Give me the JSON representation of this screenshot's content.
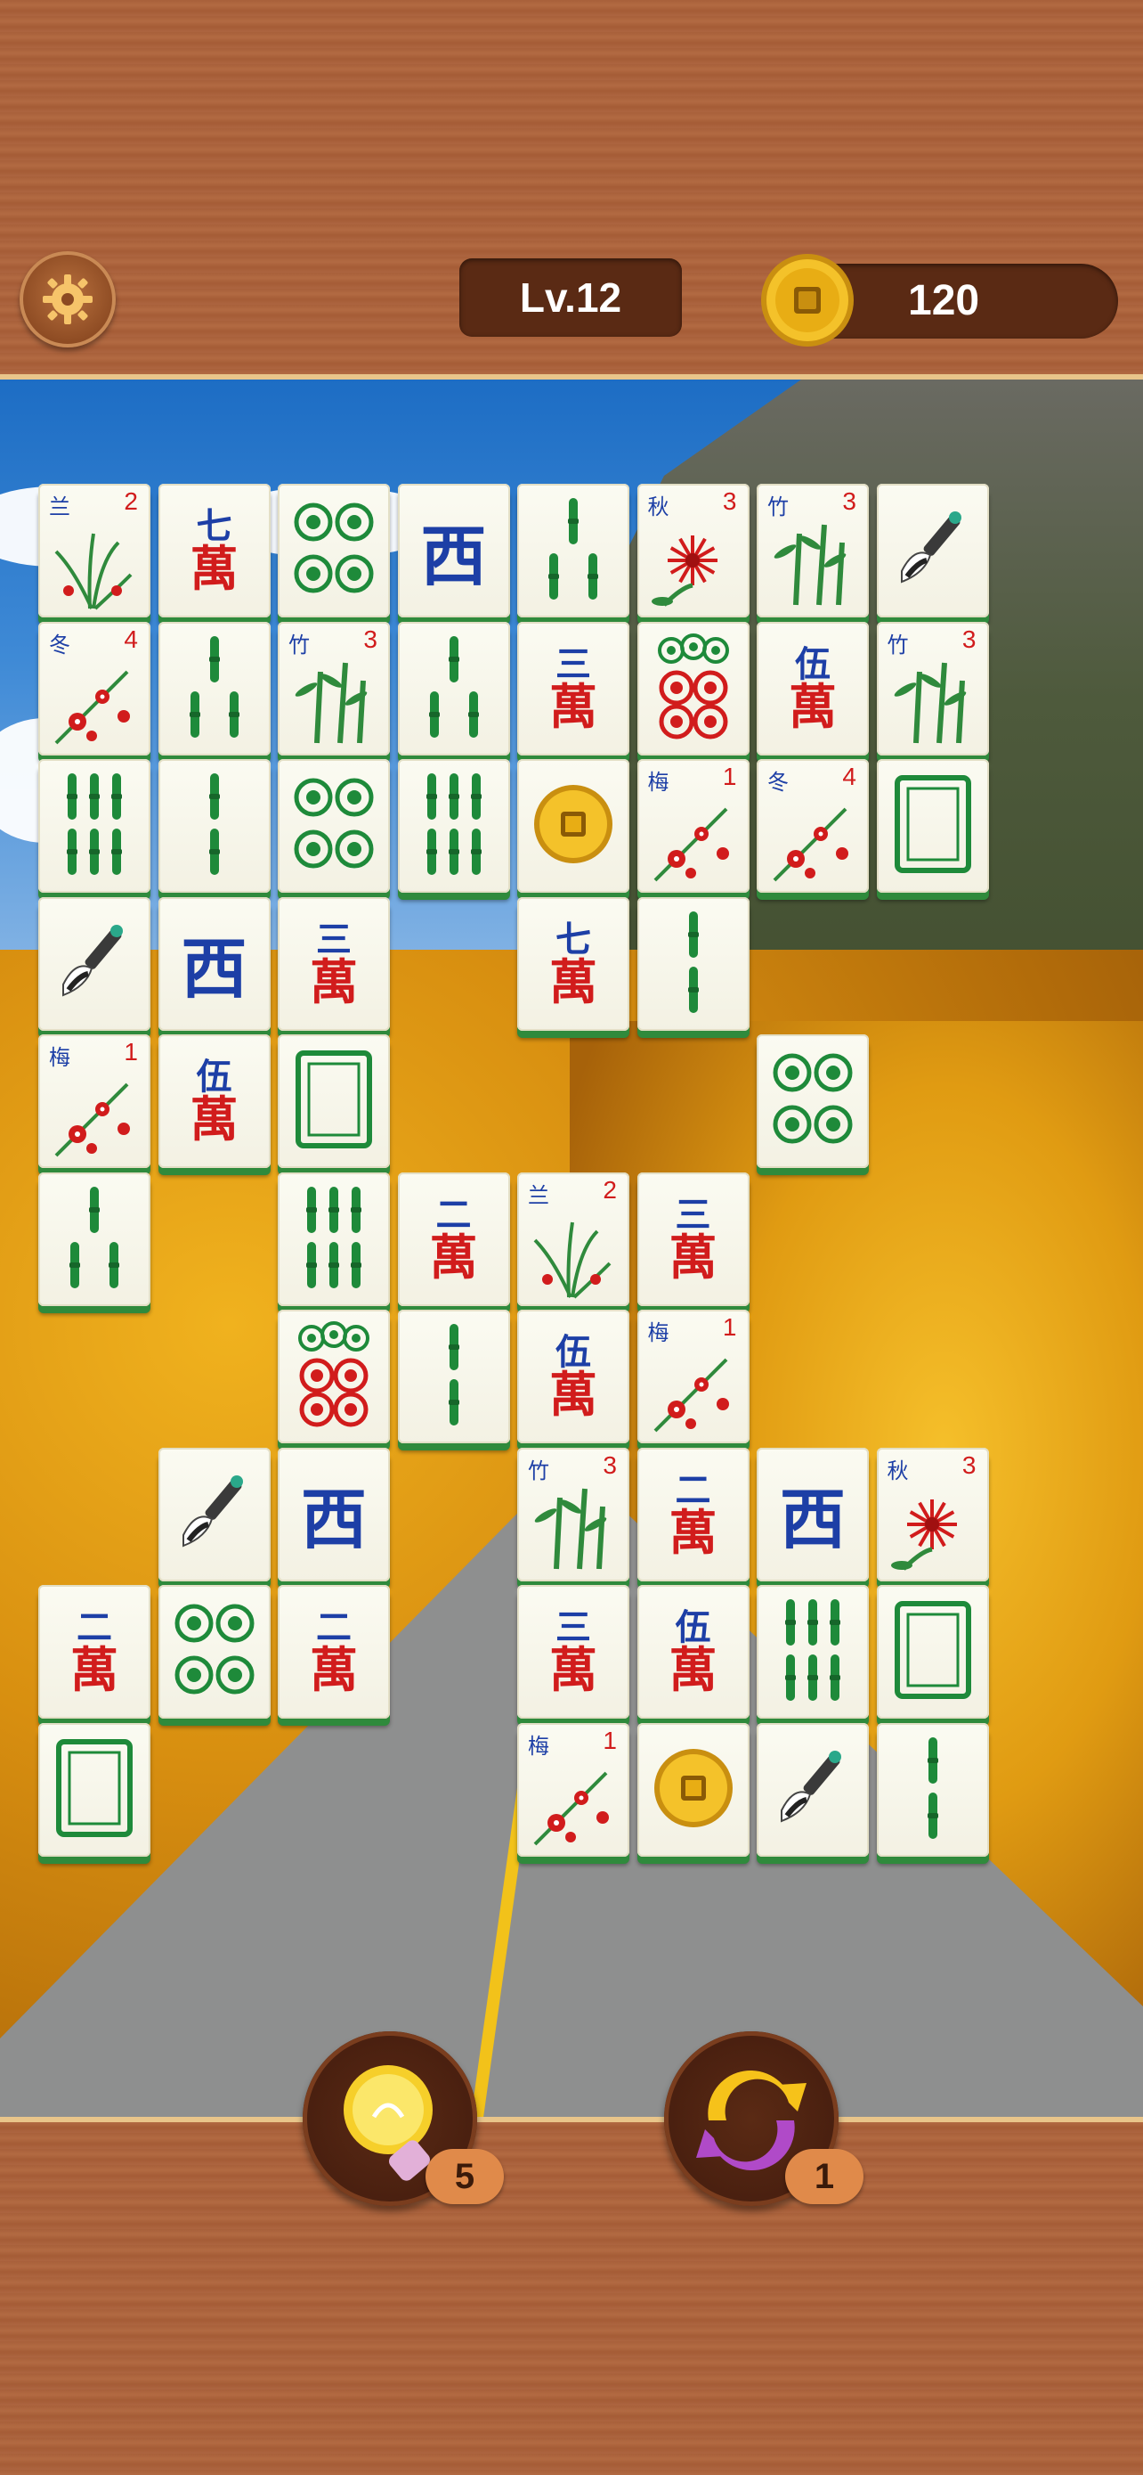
{
  "header": {
    "level_label": "Lv.12",
    "coins": "120"
  },
  "icons": {
    "settings": "gear-icon",
    "coin": "coin-icon",
    "hint": "lightbulb-icon",
    "shuffle": "shuffle-icon"
  },
  "colors": {
    "tile_face": "#f7f5e8",
    "tile_edge": "#2f8a3c",
    "wan_red": "#d11c1c",
    "wind_blue": "#1d3fa6",
    "dot_green": "#1e8a3a",
    "panel_brown": "#5a2a14"
  },
  "tiles": [
    {
      "kind": "flower",
      "cn": "兰",
      "num": "2",
      "plant": "orchid"
    },
    {
      "kind": "wan",
      "num": "七",
      "wan": "萬"
    },
    {
      "kind": "dots",
      "count": 4
    },
    {
      "kind": "wind",
      "text": "西"
    },
    {
      "kind": "bamboo",
      "count": 3
    },
    {
      "kind": "flower",
      "cn": "秋",
      "num": "3",
      "plant": "chrysanthemum"
    },
    {
      "kind": "flower",
      "cn": "竹",
      "num": "3",
      "plant": "bamboo"
    },
    {
      "kind": "brush"
    },
    {
      "kind": "flower",
      "cn": "冬",
      "num": "4",
      "plant": "plum"
    },
    {
      "kind": "bamboo",
      "count": 3
    },
    {
      "kind": "flower",
      "cn": "竹",
      "num": "3",
      "plant": "bamboo"
    },
    {
      "kind": "bamboo",
      "count": 3
    },
    {
      "kind": "wan",
      "num": "三",
      "wan": "萬"
    },
    {
      "kind": "dots5"
    },
    {
      "kind": "wan",
      "num": "伍",
      "wan": "萬"
    },
    {
      "kind": "flower",
      "cn": "竹",
      "num": "3",
      "plant": "bamboo"
    },
    {
      "kind": "bamboo",
      "count": 6
    },
    {
      "kind": "bamboo",
      "count": 2
    },
    {
      "kind": "dots",
      "count": 4
    },
    {
      "kind": "bamboo",
      "count": 6
    },
    {
      "kind": "coin"
    },
    {
      "kind": "flower",
      "cn": "梅",
      "num": "1",
      "plant": "plum"
    },
    {
      "kind": "flower",
      "cn": "冬",
      "num": "4",
      "plant": "plum"
    },
    {
      "kind": "white"
    },
    {
      "kind": "brush"
    },
    {
      "kind": "wind",
      "text": "西"
    },
    {
      "kind": "wan",
      "num": "三",
      "wan": "萬"
    },
    {
      "kind": "wan",
      "num": "七",
      "wan": "萬"
    },
    {
      "kind": "bamboo",
      "count": 2
    },
    {
      "kind": "flower",
      "cn": "梅",
      "num": "1",
      "plant": "plum"
    },
    {
      "kind": "wan",
      "num": "伍",
      "wan": "萬"
    },
    {
      "kind": "white"
    },
    {
      "kind": "dots",
      "count": 4
    },
    {
      "kind": "bamboo",
      "count": 3
    },
    {
      "kind": "bamboo",
      "count": 6
    },
    {
      "kind": "wan",
      "num": "二",
      "wan": "萬"
    },
    {
      "kind": "flower",
      "cn": "兰",
      "num": "2",
      "plant": "orchid"
    },
    {
      "kind": "wan",
      "num": "三",
      "wan": "萬"
    },
    {
      "kind": "dots5"
    },
    {
      "kind": "bamboo",
      "count": 2
    },
    {
      "kind": "wan",
      "num": "伍",
      "wan": "萬"
    },
    {
      "kind": "flower",
      "cn": "梅",
      "num": "1",
      "plant": "plum"
    },
    {
      "kind": "brush"
    },
    {
      "kind": "wind",
      "text": "西"
    },
    {
      "kind": "flower",
      "cn": "竹",
      "num": "3",
      "plant": "bamboo"
    },
    {
      "kind": "wan",
      "num": "二",
      "wan": "萬"
    },
    {
      "kind": "wind",
      "text": "西"
    },
    {
      "kind": "flower",
      "cn": "秋",
      "num": "3",
      "plant": "chrysanthemum"
    },
    {
      "kind": "wan",
      "num": "二",
      "wan": "萬"
    },
    {
      "kind": "dots",
      "count": 4
    },
    {
      "kind": "wan",
      "num": "二",
      "wan": "萬"
    },
    {
      "kind": "wan",
      "num": "三",
      "wan": "萬"
    },
    {
      "kind": "wan",
      "num": "伍",
      "wan": "萬"
    },
    {
      "kind": "bamboo",
      "count": 6
    },
    {
      "kind": "white"
    },
    {
      "kind": "white"
    },
    {
      "kind": "flower",
      "cn": "梅",
      "num": "1",
      "plant": "plum"
    },
    {
      "kind": "coin"
    },
    {
      "kind": "brush"
    },
    {
      "kind": "bamboo",
      "count": 2
    }
  ],
  "powerups": {
    "hint_count": "5",
    "shuffle_count": "1"
  }
}
